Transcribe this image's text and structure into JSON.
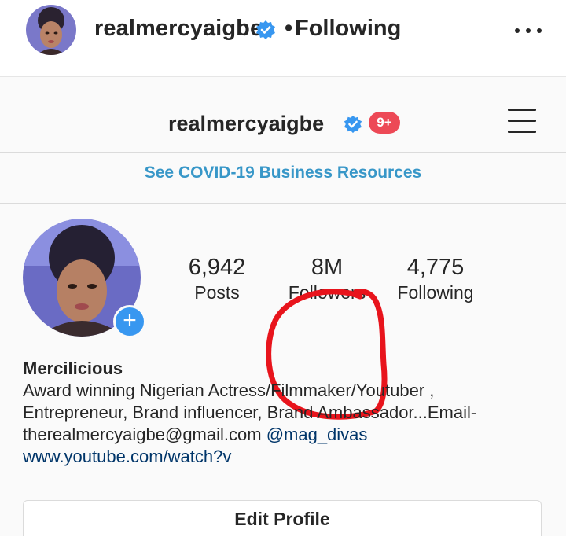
{
  "post_header": {
    "username": "realmercyaigbe",
    "separator": "•",
    "following_label": "Following",
    "verified_icon": "verified-badge-icon",
    "more_icon": "more-options-icon"
  },
  "profile_topbar": {
    "username": "realmercyaigbe",
    "notification_count": "9+",
    "menu_icon": "hamburger-menu-icon"
  },
  "covid_link": "See COVID-19 Business Resources",
  "stats": [
    {
      "value": "6,942",
      "label": "Posts"
    },
    {
      "value": "8M",
      "label": "Followers"
    },
    {
      "value": "4,775",
      "label": "Following"
    }
  ],
  "bio": {
    "name": "Mercilicious",
    "line1": "Award winning Nigerian Actress/Filmmaker/Youtuber  ,",
    "line2": "Entrepreneur, Brand influencer, Brand Ambassador...Email-",
    "line3_text": "therealmercyaigbe@gmail.com ",
    "line3_mention": "@mag_divas",
    "link": "www.youtube.com/watch?v"
  },
  "edit_profile_label": "Edit Profile",
  "colors": {
    "accent_blue": "#3897f0",
    "link_blue": "#3897c8",
    "notification_red": "#ed4956",
    "annotation_red": "#e8141c"
  }
}
